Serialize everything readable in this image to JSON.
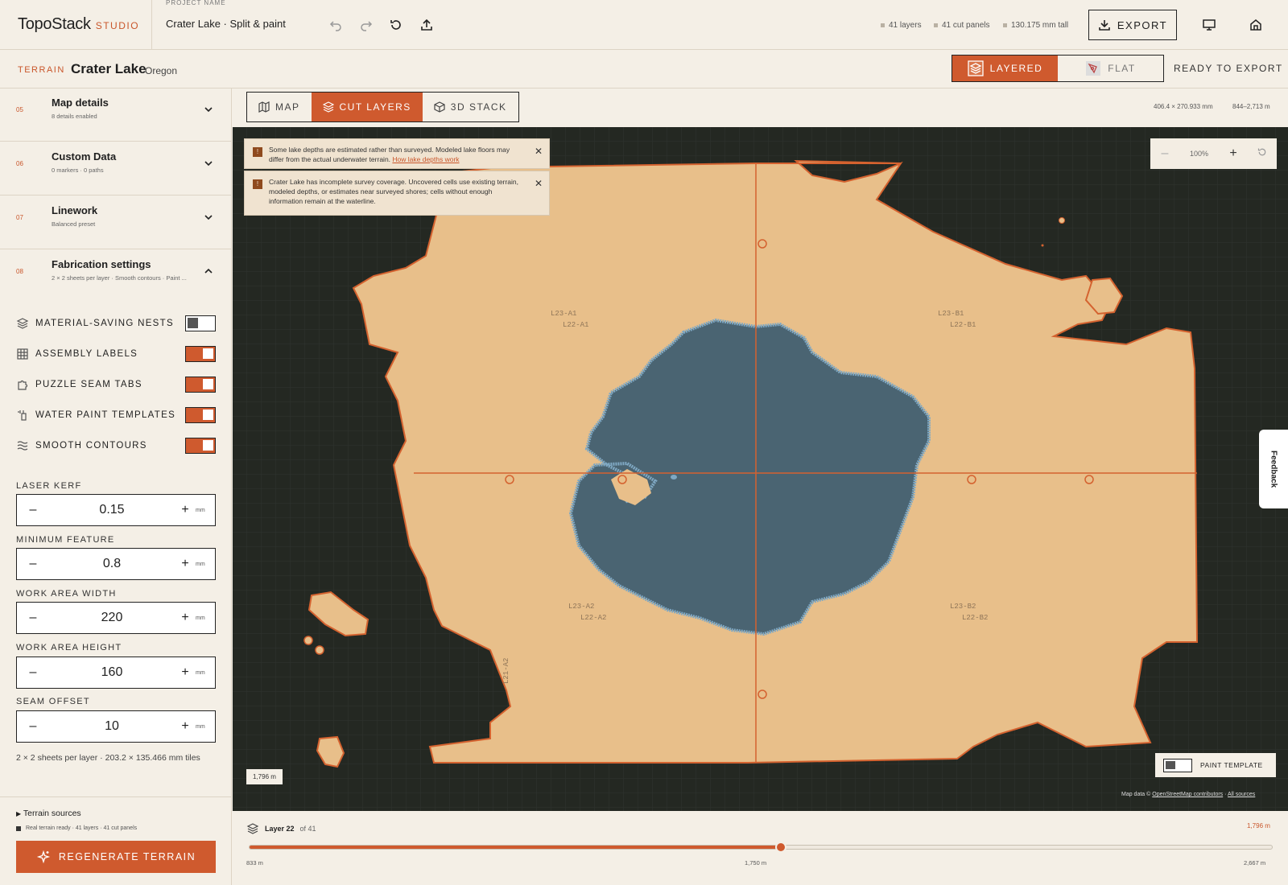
{
  "app": {
    "name": "TopoStack",
    "suffix": "STUDIO"
  },
  "project": {
    "label": "PROJECT NAME",
    "name": "Crater Lake · Split & paint"
  },
  "stats": {
    "layers": "41 layers",
    "panels": "41 cut panels",
    "height": "130.175 mm tall"
  },
  "export_label": "EXPORT",
  "terrain": {
    "tag": "TERRAIN",
    "name": "Crater Lake",
    "region": "Oregon"
  },
  "modes": {
    "layered": "LAYERED",
    "flat": "FLAT",
    "selected": "LAYERED"
  },
  "ready_label": "READY TO EXPORT",
  "sections": [
    {
      "num": "05",
      "title": "Map details",
      "sub": "8 details enabled",
      "expanded": false
    },
    {
      "num": "06",
      "title": "Custom Data",
      "sub": "0 markers · 0 paths",
      "expanded": false
    },
    {
      "num": "07",
      "title": "Linework",
      "sub": "Balanced preset",
      "expanded": false
    },
    {
      "num": "08",
      "title": "Fabrication settings",
      "sub": "2 × 2 sheets per layer · Smooth contours · Paint ...",
      "expanded": true
    }
  ],
  "toggles": [
    {
      "label": "MATERIAL-SAVING NESTS",
      "icon": "layers-icon",
      "on": false
    },
    {
      "label": "ASSEMBLY LABELS",
      "icon": "grid-icon",
      "on": true
    },
    {
      "label": "PUZZLE SEAM TABS",
      "icon": "puzzle-icon",
      "on": true
    },
    {
      "label": "WATER PAINT TEMPLATES",
      "icon": "brush-icon",
      "on": true
    },
    {
      "label": "SMOOTH CONTOURS",
      "icon": "waves-icon",
      "on": true
    }
  ],
  "fields": [
    {
      "label": "LASER KERF",
      "value": "0.15",
      "unit": "mm"
    },
    {
      "label": "MINIMUM FEATURE",
      "value": "0.8",
      "unit": "mm"
    },
    {
      "label": "WORK AREA WIDTH",
      "value": "220",
      "unit": "mm"
    },
    {
      "label": "WORK AREA HEIGHT",
      "value": "160",
      "unit": "mm"
    },
    {
      "label": "SEAM OFFSET",
      "value": "10",
      "unit": "mm"
    }
  ],
  "tiles_note": "2 × 2 sheets per layer · 203.2 × 135.466 mm tiles",
  "terrain_sources": "Terrain sources",
  "ready_status": "Real terrain ready · 41 layers · 41 cut panels",
  "regenerate_label": "REGENERATE TERRAIN",
  "view_tabs": [
    {
      "label": "MAP",
      "icon": "map-icon"
    },
    {
      "label": "CUT LAYERS",
      "icon": "layers-icon"
    },
    {
      "label": "3D STACK",
      "icon": "cube-icon"
    }
  ],
  "active_view": "CUT LAYERS",
  "dims": {
    "size": "406.4 × 270.933 mm",
    "range": "844–2,713 m"
  },
  "alerts": [
    {
      "text": "Some lake depths are estimated rather than surveyed. Modeled lake floors may differ from the actual underwater terrain.",
      "link": "How lake depths work"
    },
    {
      "text": "Crater Lake has incomplete survey coverage. Uncovered cells use existing terrain, modeled depths, or estimates near surveyed shores; cells without enough information remain at the waterline.",
      "link": ""
    }
  ],
  "zoom": {
    "value": "100%"
  },
  "panel_labels": [
    {
      "top": "L23-A1",
      "bottom": "L22-A1"
    },
    {
      "top": "L23-B1",
      "bottom": "L22-B1"
    },
    {
      "top": "L23-A2",
      "bottom": "L22-A2"
    },
    {
      "top": "L23-B2",
      "bottom": "L22-B2"
    }
  ],
  "side_label": "L21-A2",
  "scale_label": "1,796 m",
  "paint_template_label": "PAINT TEMPLATE",
  "credits": {
    "prefix": "Map data ©",
    "osm": "OpenStreetMap contributors",
    "sep": "·",
    "all": "All sources"
  },
  "feedback_label": "Feedback",
  "layer": {
    "label": "Layer 22",
    "of": "of 41",
    "current": 22,
    "total": 41,
    "elevation": "1,796 m",
    "fraction": 0.52
  },
  "ticks": {
    "min": "833 m",
    "mid": "1,750 m",
    "max": "2,667 m"
  },
  "colors": {
    "accent": "#cf5a2e",
    "land": "#e8bf8a",
    "water": "#4a6472",
    "canvas": "#242822"
  }
}
